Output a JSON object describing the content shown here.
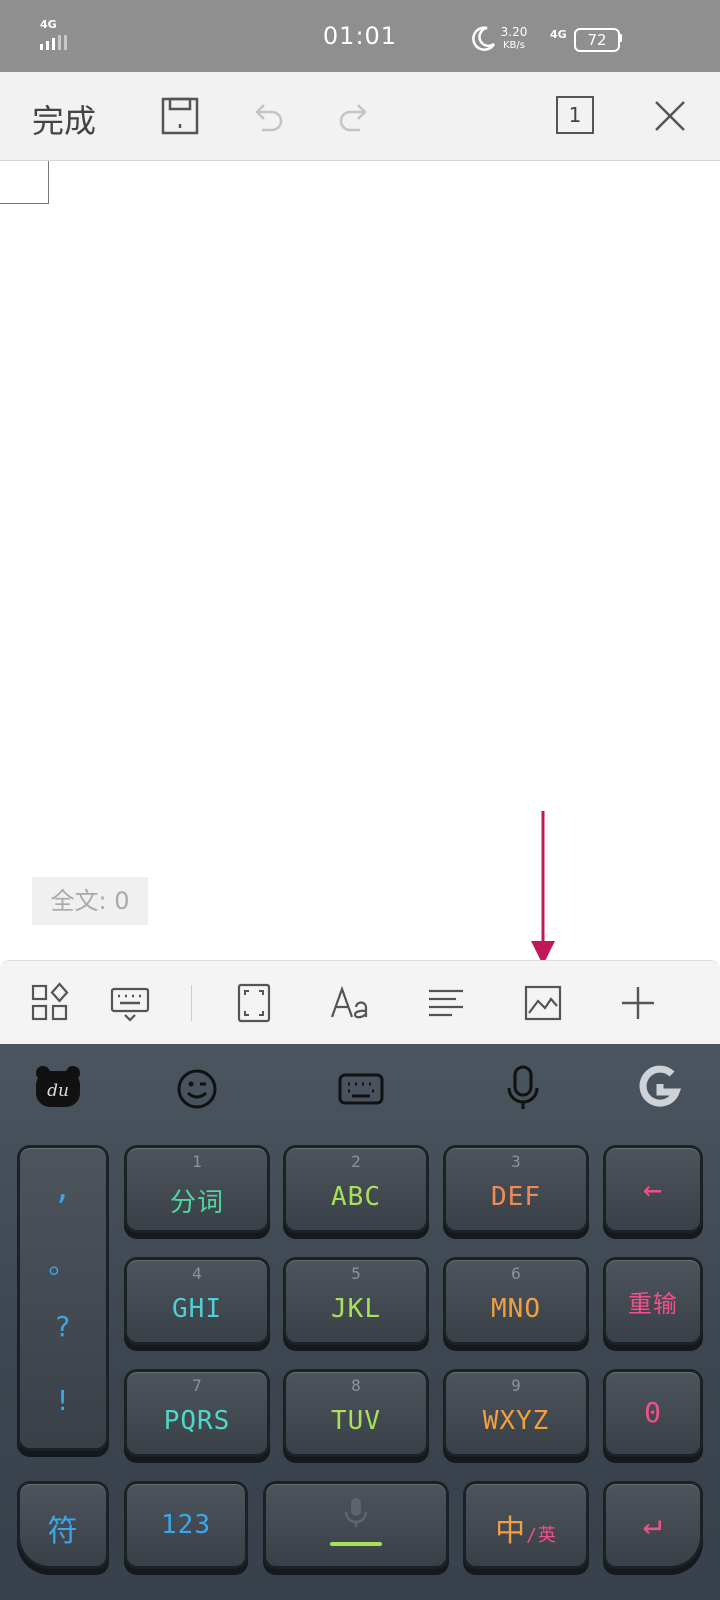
{
  "status_bar": {
    "network": "4G",
    "time": "01:01",
    "speed_value": "3.20",
    "speed_unit": "KB/s",
    "network2": "4G",
    "battery": "72"
  },
  "toolbar": {
    "done_label": "完成",
    "page_count": "1"
  },
  "document": {
    "word_count": "全文: 0"
  },
  "keyboard": {
    "punct_keys": [
      ",",
      "。",
      "?",
      "!"
    ],
    "rows": [
      [
        {
          "num": "1",
          "label": "分词",
          "color": "#4ed8a0"
        },
        {
          "num": "2",
          "label": "ABC",
          "color": "#a8e05a"
        },
        {
          "num": "3",
          "label": "DEF",
          "color": "#f08a5a"
        }
      ],
      [
        {
          "num": "4",
          "label": "GHI",
          "color": "#4ecfd8"
        },
        {
          "num": "5",
          "label": "JKL",
          "color": "#a8e05a"
        },
        {
          "num": "6",
          "label": "MNO",
          "color": "#f0a040"
        }
      ],
      [
        {
          "num": "7",
          "label": "PQRS",
          "color": "#4ed8c8"
        },
        {
          "num": "8",
          "label": "TUV",
          "color": "#a8e05a"
        },
        {
          "num": "9",
          "label": "WXYZ",
          "color": "#f0a040"
        }
      ]
    ],
    "right_keys": {
      "backspace": "←",
      "retype": "重输",
      "zero": "0"
    },
    "bottom": {
      "symbol": "符",
      "num": "123",
      "lang_main": "中",
      "lang_sub": "/英",
      "enter": "↵"
    }
  },
  "colors": {
    "pink": "#f0508a",
    "blue": "#3aa8e8",
    "arrow": "#c2185b"
  }
}
